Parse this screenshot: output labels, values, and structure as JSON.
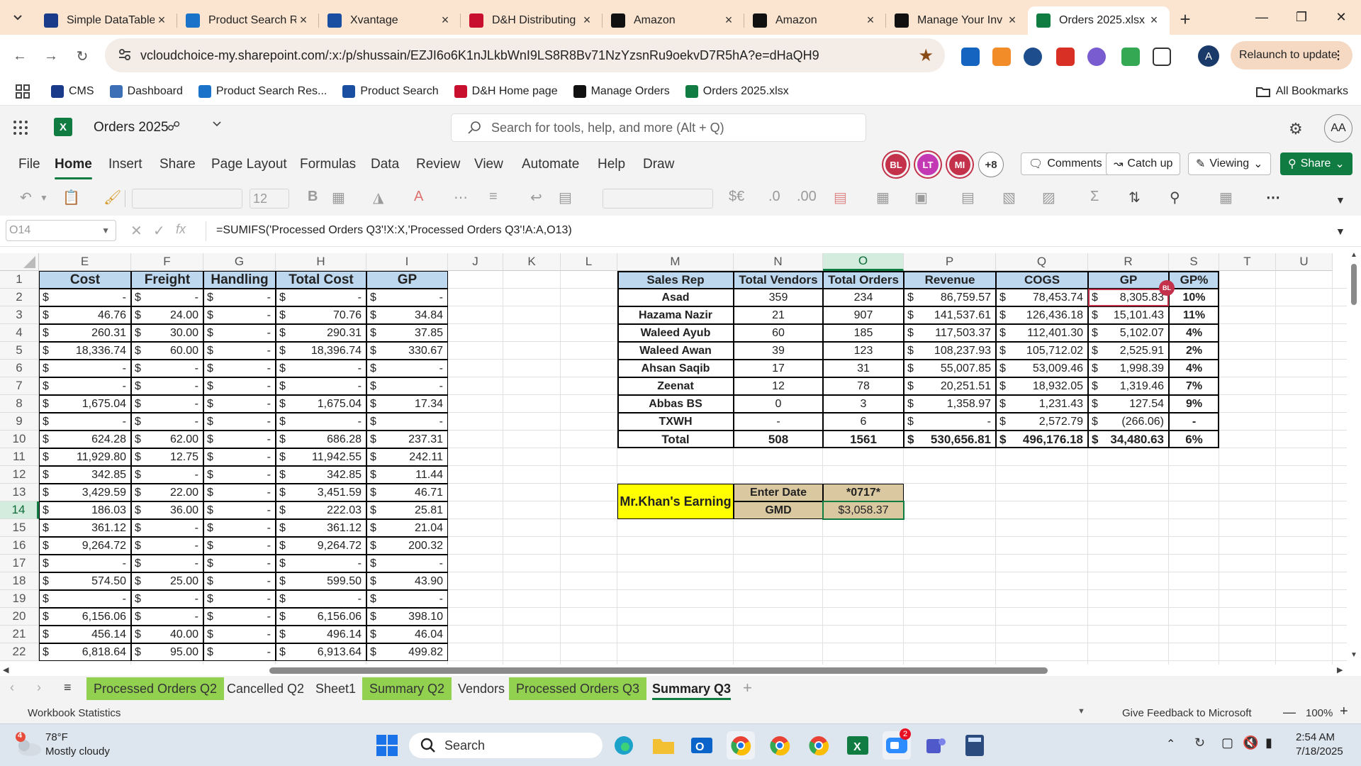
{
  "browser": {
    "tabs": [
      {
        "title": "Simple DataTable",
        "icon": "cms-favicon",
        "color": "#1a3a8a"
      },
      {
        "title": "Product Search R",
        "icon": "product-search-favicon",
        "color": "#1a73c9"
      },
      {
        "title": "Xvantage",
        "icon": "xvantage-favicon",
        "color": "#1a4ea1"
      },
      {
        "title": "D&H Distributing",
        "icon": "dh-favicon",
        "color": "#c8102e"
      },
      {
        "title": "Amazon",
        "icon": "amazon-favicon",
        "color": "#111111"
      },
      {
        "title": "Amazon",
        "icon": "amazon-favicon",
        "color": "#111111"
      },
      {
        "title": "Manage Your Inv",
        "icon": "amazon-favicon",
        "color": "#111111"
      },
      {
        "title": "Orders 2025.xlsx",
        "icon": "excel-favicon",
        "color": "#107c41",
        "active": true
      }
    ],
    "url": "vcloudchoice-my.sharepoint.com/:x:/p/shussain/EZJI6o6K1nJLkbWnI9LS8R8Bv71NzYzsnRu9oekvD7R5hA?e=dHaQH9",
    "relaunch_label": "Relaunch to update",
    "profile_initial": "A",
    "bookmarks": [
      {
        "label": "CMS",
        "color": "#1a3a8a"
      },
      {
        "label": "Dashboard",
        "color": "#3d6fb6"
      },
      {
        "label": "Product Search Res...",
        "color": "#1a73c9"
      },
      {
        "label": "Product Search",
        "color": "#1a4ea1"
      },
      {
        "label": "D&H Home page",
        "color": "#c8102e"
      },
      {
        "label": "Manage Orders",
        "color": "#111111"
      },
      {
        "label": "Orders 2025.xlsx",
        "color": "#107c41"
      }
    ],
    "all_bookmarks_label": "All Bookmarks"
  },
  "excel": {
    "file_title": "Orders 2025",
    "search_placeholder": "Search for tools, help, and more (Alt + Q)",
    "user_initials": "AA",
    "ribbon_tabs": [
      "File",
      "Home",
      "Insert",
      "Share",
      "Page Layout",
      "Formulas",
      "Data",
      "Review",
      "View",
      "Automate",
      "Help",
      "Draw"
    ],
    "active_tab": "Home",
    "collaborators": [
      {
        "initials": "BL",
        "color": "#c4314b"
      },
      {
        "initials": "LT",
        "color": "#c239b3"
      },
      {
        "initials": "MI",
        "color": "#c4314b"
      }
    ],
    "more_collaborators": "+8",
    "comments_label": "Comments",
    "catchup_label": "Catch up",
    "viewing_label": "Viewing",
    "share_label": "Share",
    "font_size": "12",
    "name_box": "O14",
    "formula": "=SUMIFS('Processed Orders Q3'!X:X,'Processed Orders Q3'!A:A,O13)",
    "accent_color": "#107c41"
  },
  "grid": {
    "columns": [
      "E",
      "F",
      "G",
      "H",
      "I",
      "J",
      "K",
      "L",
      "M",
      "N",
      "O",
      "P",
      "Q",
      "R",
      "S",
      "T",
      "U"
    ],
    "selected_column": "O",
    "selected_row": "14",
    "rows": [
      "1",
      "2",
      "3",
      "4",
      "5",
      "6",
      "7",
      "8",
      "9",
      "10",
      "11",
      "12",
      "13",
      "14",
      "15",
      "16",
      "17",
      "18",
      "19",
      "20",
      "21",
      "22"
    ],
    "left_headers": [
      "Cost",
      "Freight",
      "Handling",
      "Total Cost",
      "GP"
    ],
    "left_rows": [
      [
        "-",
        "-",
        "-",
        "-",
        "-"
      ],
      [
        "46.76",
        "24.00",
        "-",
        "70.76",
        "34.84"
      ],
      [
        "260.31",
        "30.00",
        "-",
        "290.31",
        "37.85"
      ],
      [
        "18,336.74",
        "60.00",
        "-",
        "18,396.74",
        "330.67"
      ],
      [
        "-",
        "-",
        "-",
        "-",
        "-"
      ],
      [
        "-",
        "-",
        "-",
        "-",
        "-"
      ],
      [
        "1,675.04",
        "-",
        "-",
        "1,675.04",
        "17.34"
      ],
      [
        "-",
        "-",
        "-",
        "-",
        "-"
      ],
      [
        "624.28",
        "62.00",
        "-",
        "686.28",
        "237.31"
      ],
      [
        "11,929.80",
        "12.75",
        "-",
        "11,942.55",
        "242.11"
      ],
      [
        "342.85",
        "-",
        "-",
        "342.85",
        "11.44"
      ],
      [
        "3,429.59",
        "22.00",
        "-",
        "3,451.59",
        "46.71"
      ],
      [
        "186.03",
        "36.00",
        "-",
        "222.03",
        "25.81"
      ],
      [
        "361.12",
        "-",
        "-",
        "361.12",
        "21.04"
      ],
      [
        "9,264.72",
        "-",
        "-",
        "9,264.72",
        "200.32"
      ],
      [
        "-",
        "-",
        "-",
        "-",
        "-"
      ],
      [
        "574.50",
        "25.00",
        "-",
        "599.50",
        "43.90"
      ],
      [
        "-",
        "-",
        "-",
        "-",
        "-"
      ],
      [
        "6,156.06",
        "-",
        "-",
        "6,156.06",
        "398.10"
      ],
      [
        "456.14",
        "40.00",
        "-",
        "496.14",
        "46.04"
      ],
      [
        "6,818.64",
        "95.00",
        "-",
        "6,913.64",
        "499.82"
      ]
    ],
    "currency_symbol": "$",
    "summary_headers": [
      "Sales Rep",
      "Total Vendors",
      "Total Orders",
      "Revenue",
      "COGS",
      "GP",
      "GP%"
    ],
    "summary_rows": [
      [
        "Asad",
        "359",
        "234",
        "86,759.57",
        "78,453.74",
        "8,305.83",
        "10%"
      ],
      [
        "Hazama Nazir",
        "21",
        "907",
        "141,537.61",
        "126,436.18",
        "15,101.43",
        "11%"
      ],
      [
        "Waleed Ayub",
        "60",
        "185",
        "117,503.37",
        "112,401.30",
        "5,102.07",
        "4%"
      ],
      [
        "Waleed Awan",
        "39",
        "123",
        "108,237.93",
        "105,712.02",
        "2,525.91",
        "2%"
      ],
      [
        "Ahsan Saqib",
        "17",
        "31",
        "55,007.85",
        "53,009.46",
        "1,998.39",
        "4%"
      ],
      [
        "Zeenat",
        "12",
        "78",
        "20,251.51",
        "18,932.05",
        "1,319.46",
        "7%"
      ],
      [
        "Abbas BS",
        "0",
        "3",
        "1,358.97",
        "1,231.43",
        "127.54",
        "9%"
      ],
      [
        "TXWH",
        "-",
        "6",
        "-",
        "2,572.79",
        "(266.06)",
        "-"
      ]
    ],
    "summary_total": [
      "Total",
      "508",
      "1561",
      "530,656.81",
      "496,176.18",
      "34,480.63",
      "6%"
    ],
    "earning_label": "Mr.Khan's Earning",
    "enter_date_label": "Enter Date",
    "date_value": "*0717*",
    "gmd_label": "GMD",
    "gmd_value": "$3,058.37",
    "presence_badge": "BL",
    "header_fill": "#bdd7ee",
    "earning_fill": "#ffff00",
    "label_fill": "#d9c8a0"
  },
  "sheet_tabs": [
    {
      "label": "Processed Orders Q2",
      "green": true
    },
    {
      "label": "Cancelled Q2",
      "green": false
    },
    {
      "label": "Sheet1",
      "green": false
    },
    {
      "label": "Summary Q2",
      "green": true
    },
    {
      "label": "Vendors",
      "green": false
    },
    {
      "label": "Processed Orders Q3",
      "green": true
    },
    {
      "label": "Summary Q3",
      "green": false,
      "active": true
    }
  ],
  "status": {
    "workbook_stats": "Workbook Statistics",
    "feedback": "Give Feedback to Microsoft",
    "zoom": "100%"
  },
  "taskbar": {
    "weather_temp": "78°F",
    "weather_desc": "Mostly cloudy",
    "weather_badge": "4",
    "search_label": "Search",
    "time": "2:54 AM",
    "date": "7/18/2025",
    "zoom_badge": "2"
  }
}
